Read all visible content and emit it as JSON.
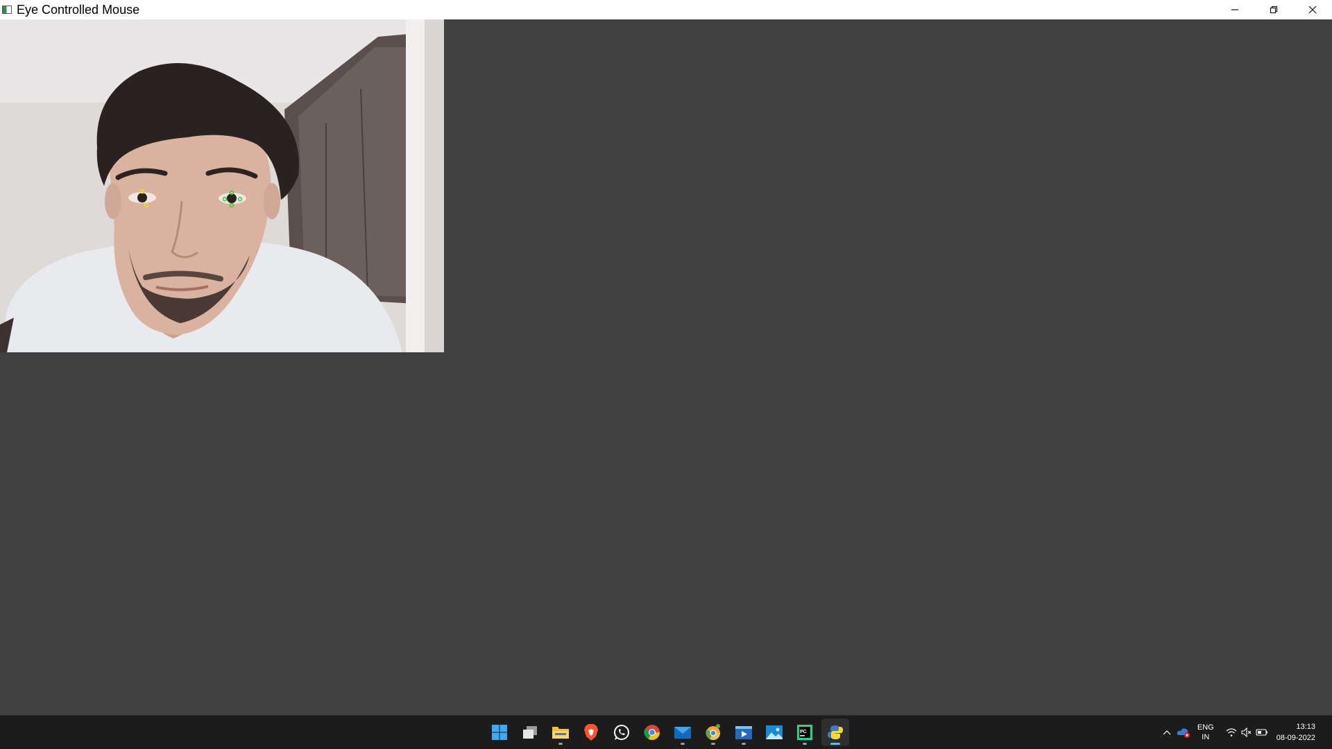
{
  "window": {
    "title": "Eye Controlled Mouse"
  },
  "taskbar": {
    "apps": [
      {
        "name": "Start",
        "icon": "windows-start-icon"
      },
      {
        "name": "Task View",
        "icon": "task-view-icon"
      },
      {
        "name": "File Explorer",
        "icon": "file-explorer-icon"
      },
      {
        "name": "Brave",
        "icon": "brave-icon"
      },
      {
        "name": "WhatsApp",
        "icon": "whatsapp-icon"
      },
      {
        "name": "Google Chrome",
        "icon": "chrome-icon"
      },
      {
        "name": "Mail",
        "icon": "mail-icon"
      },
      {
        "name": "Chrome Canary",
        "icon": "chrome-canary-icon"
      },
      {
        "name": "Video Editor",
        "icon": "video-editor-icon"
      },
      {
        "name": "Photos",
        "icon": "photos-icon"
      },
      {
        "name": "PyCharm",
        "icon": "pycharm-icon"
      },
      {
        "name": "Python",
        "icon": "python-icon"
      }
    ],
    "tray": {
      "language_line1": "ENG",
      "language_line2": "IN",
      "time": "13:13",
      "date": "08-09-2022"
    }
  },
  "colors": {
    "window_background": "#404040",
    "taskbar": "#1c1c1c",
    "landmark_green": "#22dd22",
    "landmark_yellow": "#e8e800"
  }
}
